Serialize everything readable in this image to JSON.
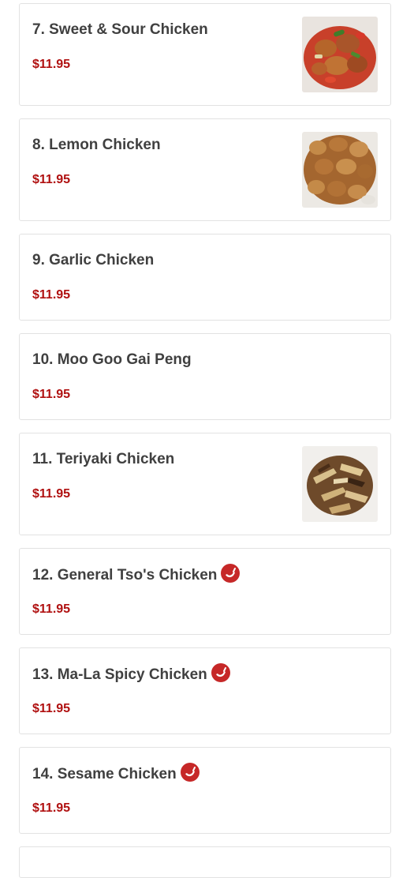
{
  "items": [
    {
      "name": "7. Sweet & Sour Chicken",
      "price": "$11.95",
      "image": "sweet-sour-chicken-photo",
      "spicy": false
    },
    {
      "name": "8. Lemon Chicken",
      "price": "$11.95",
      "image": "lemon-chicken-photo",
      "spicy": false
    },
    {
      "name": "9. Garlic Chicken",
      "price": "$11.95",
      "image": null,
      "spicy": false
    },
    {
      "name": "10. Moo Goo Gai Peng",
      "price": "$11.95",
      "image": null,
      "spicy": false
    },
    {
      "name": "11. Teriyaki Chicken",
      "price": "$11.95",
      "image": "teriyaki-chicken-photo",
      "spicy": false
    },
    {
      "name": "12. General Tso's Chicken",
      "price": "$11.95",
      "image": null,
      "spicy": true
    },
    {
      "name": "13. Ma-La Spicy Chicken",
      "price": "$11.95",
      "image": null,
      "spicy": true
    },
    {
      "name": "14. Sesame Chicken",
      "price": "$11.95",
      "image": null,
      "spicy": true
    }
  ],
  "icons": {
    "spicy": "chili-pepper-icon"
  },
  "colors": {
    "price": "#b01010",
    "name": "#404040",
    "spicy_badge": "#c62828",
    "card_border": "#e2e2e2"
  }
}
